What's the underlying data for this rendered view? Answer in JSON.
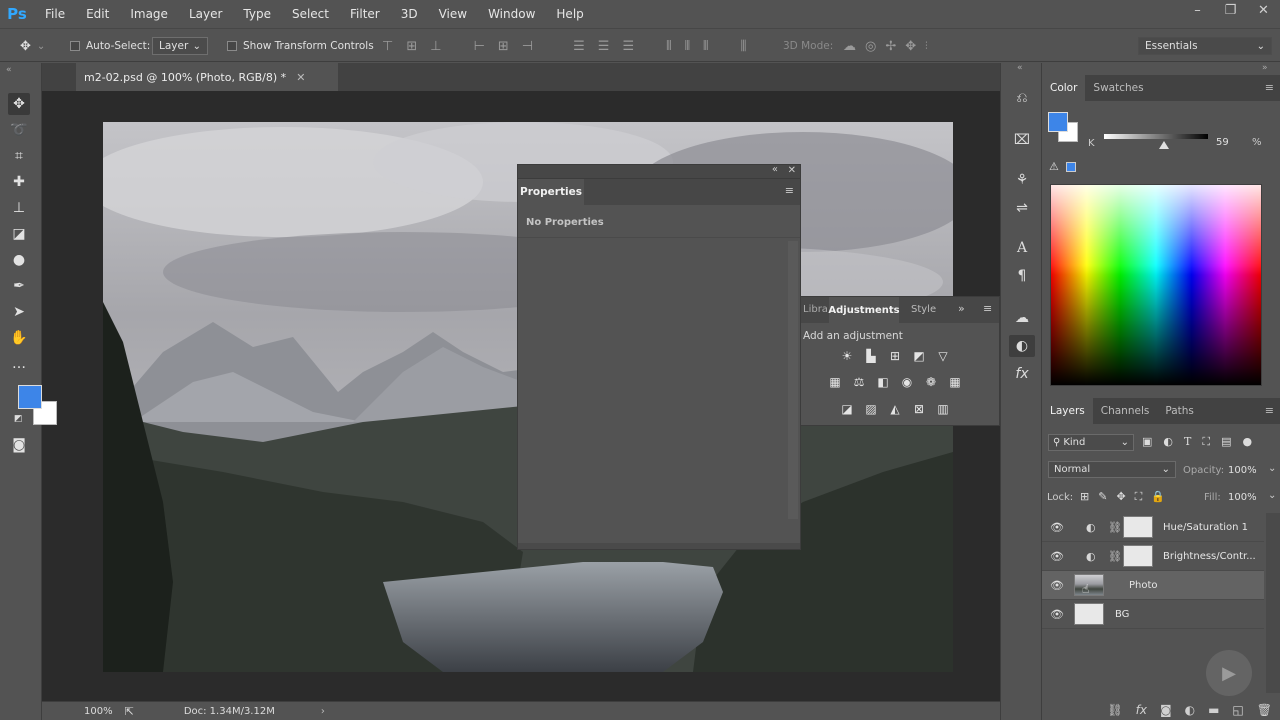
{
  "app": {
    "logo": "Ps"
  },
  "menu": [
    "File",
    "Edit",
    "Image",
    "Layer",
    "Type",
    "Select",
    "Filter",
    "3D",
    "View",
    "Window",
    "Help"
  ],
  "window_controls": [
    "–",
    "❐",
    "✕"
  ],
  "options": {
    "auto_select_label": "Auto-Select:",
    "auto_select_value": "Layer",
    "show_transform_label": "Show Transform Controls",
    "mode_3d_label": "3D Mode:",
    "workspace": "Essentials"
  },
  "document": {
    "tab_title": "m2-02.psd @ 100% (Photo, RGB/8) *",
    "zoom": "100%",
    "doc_size": "Doc: 1.34M/3.12M"
  },
  "properties_panel": {
    "tab": "Properties",
    "content": "No Properties"
  },
  "adjustments_panel": {
    "tabs": [
      "Libra",
      "Adjustments",
      "Style"
    ],
    "active_tab": "Adjustments",
    "heading": "Add an adjustment",
    "icons_row1": [
      "brightness-contrast-icon",
      "levels-icon",
      "curves-icon",
      "exposure-icon",
      "vibrance-icon"
    ],
    "icons_row2": [
      "hue-saturation-icon",
      "color-balance-icon",
      "black-white-icon",
      "photo-filter-icon",
      "channel-mixer-icon",
      "color-lookup-icon"
    ],
    "icons_row3": [
      "invert-icon",
      "posterize-icon",
      "threshold-icon",
      "selective-color-icon",
      "gradient-map-icon"
    ]
  },
  "color_panel": {
    "tabs": [
      "Color",
      "Swatches"
    ],
    "active_tab": "Color",
    "slider_label": "K",
    "slider_value": "59",
    "slider_unit": "%",
    "foreground": "#3d85e8",
    "background": "#ffffff"
  },
  "layers_panel": {
    "tabs": [
      "Layers",
      "Channels",
      "Paths"
    ],
    "active_tab": "Layers",
    "filter_kind": "Kind",
    "blend_mode": "Normal",
    "opacity_label": "Opacity:",
    "opacity": "100%",
    "lock_label": "Lock:",
    "fill_label": "Fill:",
    "fill": "100%",
    "layers": [
      {
        "name": "Hue/Saturation 1",
        "type": "adjustment"
      },
      {
        "name": "Brightness/Contr...",
        "type": "adjustment"
      },
      {
        "name": "Photo",
        "type": "pixel",
        "selected": true
      },
      {
        "name": "BG",
        "type": "pixel"
      }
    ]
  },
  "colors": {
    "ui_bg": "#535353",
    "ui_dark": "#424242",
    "canvas_bg": "#2b2b2b",
    "accent": "#31a8ff"
  }
}
